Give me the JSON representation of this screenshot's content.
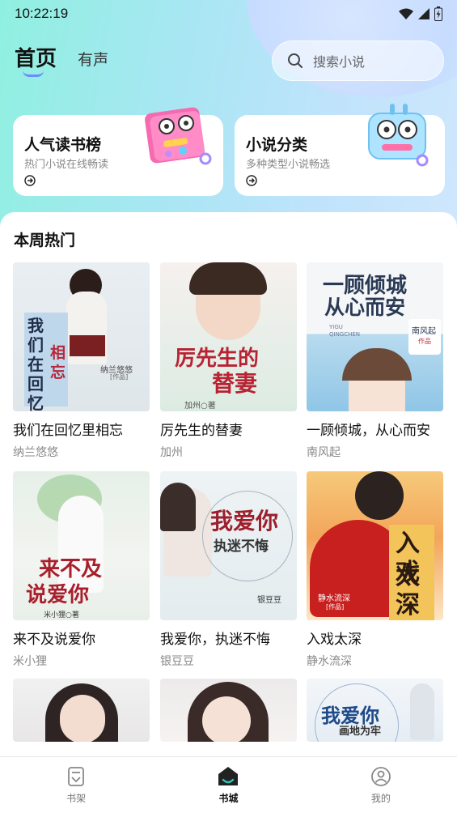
{
  "status_bar": {
    "time": "10:22:19"
  },
  "header": {
    "tabs": [
      {
        "label": "首页",
        "active": true
      },
      {
        "label": "有声",
        "active": false
      }
    ],
    "search": {
      "placeholder": "搜索小说"
    }
  },
  "promos": [
    {
      "title": "人气读书榜",
      "subtitle": "热门小说在线畅读",
      "icon": "arrow-right-circle-icon"
    },
    {
      "title": "小说分类",
      "subtitle": "多种类型小说畅选",
      "icon": "arrow-right-circle-icon"
    }
  ],
  "section": {
    "title": "本周热门"
  },
  "books": [
    {
      "title": "我们在回忆里相忘",
      "author": "纳兰悠悠",
      "cover_text": "我们在回忆里",
      "cover_text2": "相忘",
      "cover_author": "纳兰悠悠",
      "cover_author_tag": "[作品]"
    },
    {
      "title": "厉先生的替妻",
      "author": "加州",
      "cover_text": "厉先生的",
      "cover_text2": "替妻",
      "cover_author": "加州○著"
    },
    {
      "title": "一顾倾城，从心而安",
      "author": "南风起",
      "cover_text": "一顾倾城",
      "cover_text2": "从心而安",
      "cover_author": "南风起",
      "cover_author_tag": "作品",
      "cover_pinyin": "YIGU QINGCHEN"
    },
    {
      "title": "来不及说爱你",
      "author": "米小狸",
      "cover_text": "来不及",
      "cover_text2": "说爱你",
      "cover_author": "米小狸○著"
    },
    {
      "title": "我爱你，执迷不悔",
      "author": "银豆豆",
      "cover_text": "我爱你",
      "cover_text2": "执迷不悔",
      "cover_author": "银豆豆"
    },
    {
      "title": "入戏太深",
      "author": "静水流深",
      "cover_text": "入戏",
      "cover_text2": "太深",
      "cover_author": "静水流深",
      "cover_author_tag": "[作品]"
    },
    {
      "title": "",
      "author": ""
    },
    {
      "title": "",
      "author": ""
    },
    {
      "title": "",
      "author": "",
      "cover_text": "我爱你",
      "cover_text2": "画地为牢"
    }
  ],
  "bottom_nav": [
    {
      "label": "书架",
      "icon": "bookshelf-icon",
      "active": false
    },
    {
      "label": "书城",
      "icon": "bookstore-icon",
      "active": true
    },
    {
      "label": "我的",
      "icon": "profile-icon",
      "active": false
    }
  ],
  "colors": {
    "accent": "#2fc0b3",
    "hero_start": "#8ff0e0",
    "hero_end": "#cfe7fd"
  }
}
